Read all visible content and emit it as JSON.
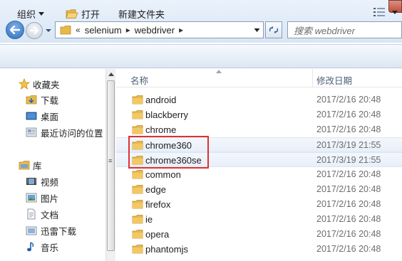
{
  "address_bar": {
    "overflow_marker": "«",
    "breadcrumbs": [
      "selenium",
      "webdriver"
    ],
    "search_placeholder": "搜索 webdriver"
  },
  "command_bar": {
    "organize_label": "组织",
    "open_label": "打开",
    "new_folder_label": "新建文件夹"
  },
  "nav_pane": {
    "favorites": {
      "label": "收藏夹",
      "items": [
        "下载",
        "桌面",
        "最近访问的位置"
      ]
    },
    "libraries": {
      "label": "库",
      "items": [
        "视频",
        "图片",
        "文档",
        "迅雷下载",
        "音乐"
      ]
    }
  },
  "file_list": {
    "columns": {
      "name": "名称",
      "date_modified": "修改日期"
    },
    "rows": [
      {
        "name": "android",
        "date": "2017/2/16 20:48",
        "highlighted": false
      },
      {
        "name": "blackberry",
        "date": "2017/2/16 20:48",
        "highlighted": false
      },
      {
        "name": "chrome",
        "date": "2017/2/16 20:48",
        "highlighted": false
      },
      {
        "name": "chrome360",
        "date": "2017/3/19 21:55",
        "highlighted": true
      },
      {
        "name": "chrome360se",
        "date": "2017/3/19 21:55",
        "highlighted": true
      },
      {
        "name": "common",
        "date": "2017/2/16 20:48",
        "highlighted": false
      },
      {
        "name": "edge",
        "date": "2017/2/16 20:48",
        "highlighted": false
      },
      {
        "name": "firefox",
        "date": "2017/2/16 20:48",
        "highlighted": false
      },
      {
        "name": "ie",
        "date": "2017/2/16 20:48",
        "highlighted": false
      },
      {
        "name": "opera",
        "date": "2017/2/16 20:48",
        "highlighted": false
      },
      {
        "name": "phantomjs",
        "date": "2017/2/16 20:48",
        "highlighted": false
      }
    ]
  },
  "colors": {
    "annotation_box": "#e0312f",
    "folder": "#e8b84a"
  }
}
